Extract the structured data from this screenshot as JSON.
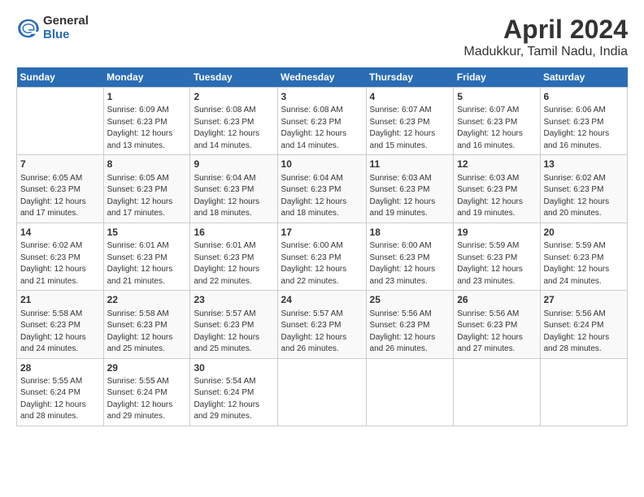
{
  "logo": {
    "general": "General",
    "blue": "Blue"
  },
  "title": "April 2024",
  "subtitle": "Madukkur, Tamil Nadu, India",
  "headers": [
    "Sunday",
    "Monday",
    "Tuesday",
    "Wednesday",
    "Thursday",
    "Friday",
    "Saturday"
  ],
  "weeks": [
    [
      {
        "day": "",
        "content": ""
      },
      {
        "day": "1",
        "content": "Sunrise: 6:09 AM\nSunset: 6:23 PM\nDaylight: 12 hours\nand 13 minutes."
      },
      {
        "day": "2",
        "content": "Sunrise: 6:08 AM\nSunset: 6:23 PM\nDaylight: 12 hours\nand 14 minutes."
      },
      {
        "day": "3",
        "content": "Sunrise: 6:08 AM\nSunset: 6:23 PM\nDaylight: 12 hours\nand 14 minutes."
      },
      {
        "day": "4",
        "content": "Sunrise: 6:07 AM\nSunset: 6:23 PM\nDaylight: 12 hours\nand 15 minutes."
      },
      {
        "day": "5",
        "content": "Sunrise: 6:07 AM\nSunset: 6:23 PM\nDaylight: 12 hours\nand 16 minutes."
      },
      {
        "day": "6",
        "content": "Sunrise: 6:06 AM\nSunset: 6:23 PM\nDaylight: 12 hours\nand 16 minutes."
      }
    ],
    [
      {
        "day": "7",
        "content": "Sunrise: 6:05 AM\nSunset: 6:23 PM\nDaylight: 12 hours\nand 17 minutes."
      },
      {
        "day": "8",
        "content": "Sunrise: 6:05 AM\nSunset: 6:23 PM\nDaylight: 12 hours\nand 17 minutes."
      },
      {
        "day": "9",
        "content": "Sunrise: 6:04 AM\nSunset: 6:23 PM\nDaylight: 12 hours\nand 18 minutes."
      },
      {
        "day": "10",
        "content": "Sunrise: 6:04 AM\nSunset: 6:23 PM\nDaylight: 12 hours\nand 18 minutes."
      },
      {
        "day": "11",
        "content": "Sunrise: 6:03 AM\nSunset: 6:23 PM\nDaylight: 12 hours\nand 19 minutes."
      },
      {
        "day": "12",
        "content": "Sunrise: 6:03 AM\nSunset: 6:23 PM\nDaylight: 12 hours\nand 19 minutes."
      },
      {
        "day": "13",
        "content": "Sunrise: 6:02 AM\nSunset: 6:23 PM\nDaylight: 12 hours\nand 20 minutes."
      }
    ],
    [
      {
        "day": "14",
        "content": "Sunrise: 6:02 AM\nSunset: 6:23 PM\nDaylight: 12 hours\nand 21 minutes."
      },
      {
        "day": "15",
        "content": "Sunrise: 6:01 AM\nSunset: 6:23 PM\nDaylight: 12 hours\nand 21 minutes."
      },
      {
        "day": "16",
        "content": "Sunrise: 6:01 AM\nSunset: 6:23 PM\nDaylight: 12 hours\nand 22 minutes."
      },
      {
        "day": "17",
        "content": "Sunrise: 6:00 AM\nSunset: 6:23 PM\nDaylight: 12 hours\nand 22 minutes."
      },
      {
        "day": "18",
        "content": "Sunrise: 6:00 AM\nSunset: 6:23 PM\nDaylight: 12 hours\nand 23 minutes."
      },
      {
        "day": "19",
        "content": "Sunrise: 5:59 AM\nSunset: 6:23 PM\nDaylight: 12 hours\nand 23 minutes."
      },
      {
        "day": "20",
        "content": "Sunrise: 5:59 AM\nSunset: 6:23 PM\nDaylight: 12 hours\nand 24 minutes."
      }
    ],
    [
      {
        "day": "21",
        "content": "Sunrise: 5:58 AM\nSunset: 6:23 PM\nDaylight: 12 hours\nand 24 minutes."
      },
      {
        "day": "22",
        "content": "Sunrise: 5:58 AM\nSunset: 6:23 PM\nDaylight: 12 hours\nand 25 minutes."
      },
      {
        "day": "23",
        "content": "Sunrise: 5:57 AM\nSunset: 6:23 PM\nDaylight: 12 hours\nand 25 minutes."
      },
      {
        "day": "24",
        "content": "Sunrise: 5:57 AM\nSunset: 6:23 PM\nDaylight: 12 hours\nand 26 minutes."
      },
      {
        "day": "25",
        "content": "Sunrise: 5:56 AM\nSunset: 6:23 PM\nDaylight: 12 hours\nand 26 minutes."
      },
      {
        "day": "26",
        "content": "Sunrise: 5:56 AM\nSunset: 6:23 PM\nDaylight: 12 hours\nand 27 minutes."
      },
      {
        "day": "27",
        "content": "Sunrise: 5:56 AM\nSunset: 6:24 PM\nDaylight: 12 hours\nand 28 minutes."
      }
    ],
    [
      {
        "day": "28",
        "content": "Sunrise: 5:55 AM\nSunset: 6:24 PM\nDaylight: 12 hours\nand 28 minutes."
      },
      {
        "day": "29",
        "content": "Sunrise: 5:55 AM\nSunset: 6:24 PM\nDaylight: 12 hours\nand 29 minutes."
      },
      {
        "day": "30",
        "content": "Sunrise: 5:54 AM\nSunset: 6:24 PM\nDaylight: 12 hours\nand 29 minutes."
      },
      {
        "day": "",
        "content": ""
      },
      {
        "day": "",
        "content": ""
      },
      {
        "day": "",
        "content": ""
      },
      {
        "day": "",
        "content": ""
      }
    ]
  ]
}
